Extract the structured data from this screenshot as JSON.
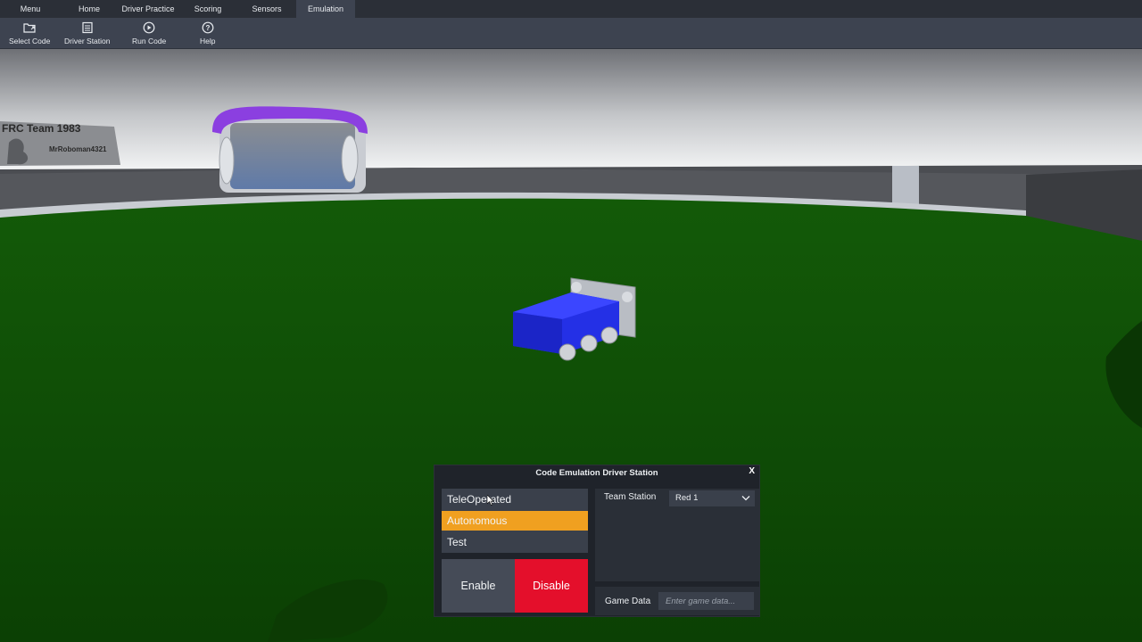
{
  "nav": {
    "tabs": [
      "Menu",
      "Home",
      "Driver Practice",
      "Scoring",
      "Sensors",
      "Emulation"
    ],
    "active_tab": "Emulation"
  },
  "toolbar": {
    "select_code": "Select Code",
    "driver_station": "Driver Station",
    "run_code": "Run Code",
    "help": "Help"
  },
  "scene": {
    "banner_team": "FRC Team 1983",
    "banner_user": "MrRoboman4321"
  },
  "driver_station": {
    "title": "Code Emulation Driver Station",
    "close": "X",
    "modes": [
      "TeleOperated",
      "Autonomous",
      "Test"
    ],
    "selected_mode": "Autonomous",
    "enable": "Enable",
    "disable": "Disable",
    "team_station_label": "Team Station",
    "team_station_value": "Red 1",
    "game_data_label": "Game Data",
    "game_data_placeholder": "Enter game data...",
    "game_data_value": ""
  },
  "colors": {
    "nav_bg": "#2b2f37",
    "toolbar_bg": "#3d4350",
    "field_green": "#0f4a06",
    "selected_mode": "#f0a020",
    "disable_red": "#e40f2b",
    "robot_blue": "#1f2de8",
    "goal_purple": "#8b3fe0"
  }
}
